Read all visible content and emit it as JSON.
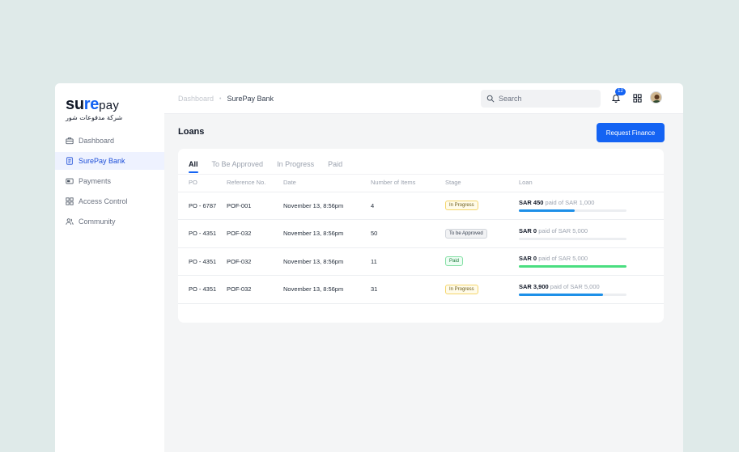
{
  "logo": {
    "name_bold": "su",
    "name_accent": "re",
    "name_light": "pay",
    "subtitle": "شركة مدفوعات شور"
  },
  "sidebar": {
    "items": [
      {
        "label": "Dashboard",
        "icon": "briefcase-icon",
        "active": false
      },
      {
        "label": "SurePay Bank",
        "icon": "document-icon",
        "active": true
      },
      {
        "label": "Payments",
        "icon": "card-icon",
        "active": false
      },
      {
        "label": "Access Control",
        "icon": "grid-icon",
        "active": false
      },
      {
        "label": "Community",
        "icon": "users-icon",
        "active": false
      }
    ]
  },
  "topbar": {
    "breadcrumb": {
      "parent": "Dashboard",
      "separator": "•",
      "current": "SurePay Bank"
    },
    "search_placeholder": "Search",
    "notification_count": "12"
  },
  "page": {
    "title": "Loans",
    "request_button": "Request Finance"
  },
  "tabs": [
    "All",
    "To Be Approved",
    "In Progress",
    "Paid"
  ],
  "table": {
    "headers": [
      "PO",
      "Reference No.",
      "Date",
      "Number of Items",
      "Stage",
      "Loan"
    ],
    "rows": [
      {
        "po": "PO - 6787",
        "ref": "POF-001",
        "date": "November 13, 8:56pm",
        "items": "4",
        "stage": "In Progress",
        "stage_type": "progress",
        "loan_amount": "SAR 450",
        "loan_rest": "paid of SAR 1,000",
        "progress": 0.52,
        "bar_color": "#1e90e8"
      },
      {
        "po": "PO - 4351",
        "ref": "POF-032",
        "date": "November 13, 8:56pm",
        "items": "50",
        "stage": "To be Approved",
        "stage_type": "approve",
        "loan_amount": "SAR 0",
        "loan_rest": "paid of SAR 5,000",
        "progress": 0.0,
        "bar_color": "#1e90e8"
      },
      {
        "po": "PO - 4351",
        "ref": "POF-032",
        "date": "November 13, 8:56pm",
        "items": "11",
        "stage": "Paid",
        "stage_type": "paid",
        "loan_amount": "SAR 0",
        "loan_rest": "paid of SAR 5,000",
        "progress": 1.0,
        "bar_color": "#4ade80"
      },
      {
        "po": "PO - 4351",
        "ref": "POF-032",
        "date": "November 13, 8:56pm",
        "items": "31",
        "stage": "In Progress",
        "stage_type": "progress",
        "loan_amount": "SAR 3,900",
        "loan_rest": "paid of SAR 5,000",
        "progress": 0.78,
        "bar_color": "#1e90e8"
      }
    ]
  },
  "colors": {
    "accent": "#1463f3",
    "background": "#dfeae9"
  }
}
